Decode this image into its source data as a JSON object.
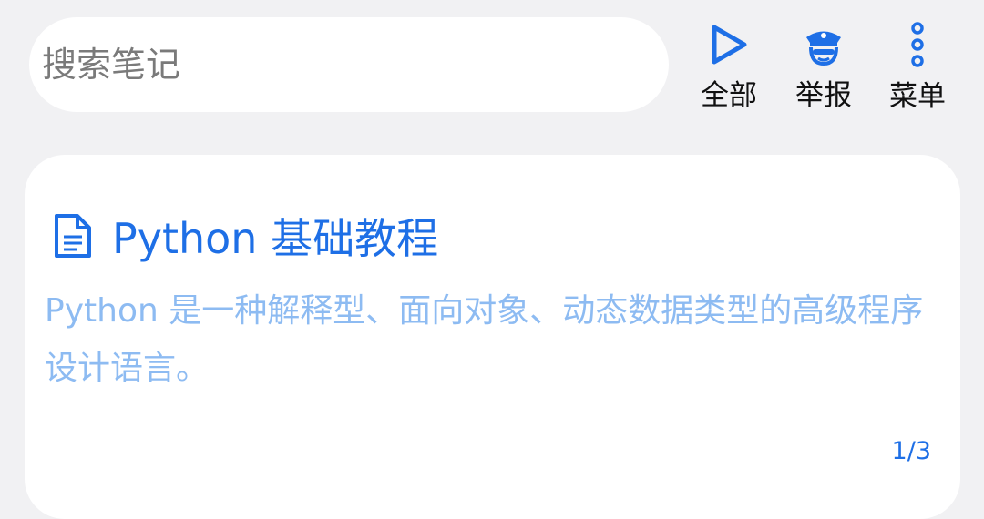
{
  "search": {
    "placeholder": "搜索笔记"
  },
  "actions": [
    {
      "icon": "play-icon",
      "label": "全部"
    },
    {
      "icon": "police-icon",
      "label": "举报"
    },
    {
      "icon": "more-vertical-icon",
      "label": "菜单"
    }
  ],
  "note": {
    "icon": "document-icon",
    "title": "Python 基础教程",
    "description": "Python 是一种解释型、面向对象、动态数据类型的高级程序设计语言。",
    "page_indicator": "1/3"
  },
  "colors": {
    "accent": "#1e6fe6",
    "description_text": "#8dbbf2",
    "background": "#f1f1f3"
  }
}
